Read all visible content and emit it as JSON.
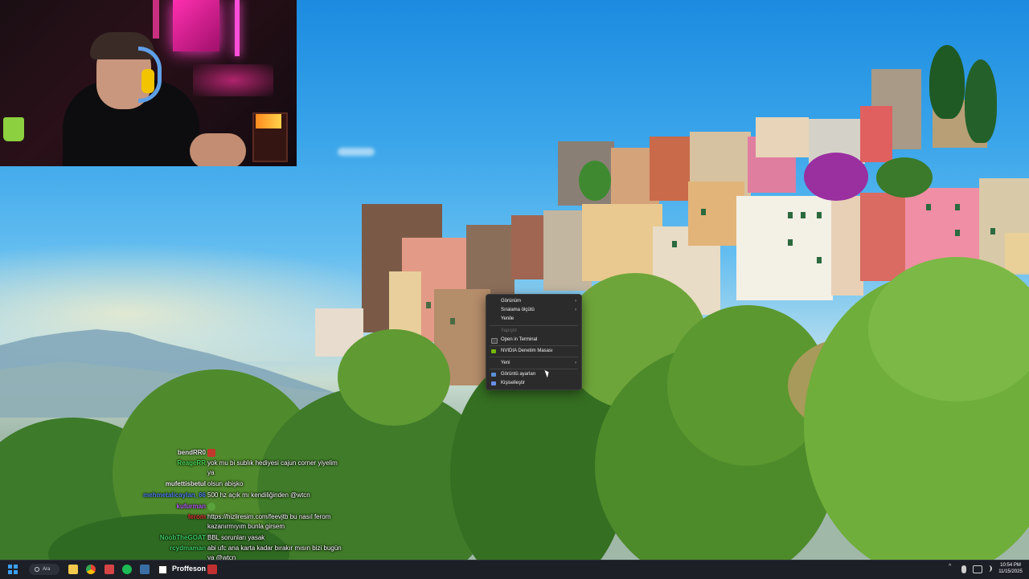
{
  "context_menu": {
    "items": [
      {
        "label": "Görünüm",
        "submenu": true,
        "icon": "",
        "disabled": false
      },
      {
        "label": "Sıralama ölçütü",
        "submenu": true,
        "icon": "",
        "disabled": false
      },
      {
        "label": "Yenile",
        "submenu": false,
        "icon": "",
        "disabled": false
      },
      {
        "label": "Yapıştır",
        "submenu": false,
        "icon": "",
        "disabled": true
      },
      {
        "label": "Open in Terminal",
        "submenu": false,
        "icon": "terminal-icon",
        "disabled": false
      },
      {
        "label": "NVIDIA Denetim Masası",
        "submenu": false,
        "icon": "nvidia-icon",
        "disabled": false
      },
      {
        "label": "Yeni",
        "submenu": true,
        "icon": "",
        "disabled": false
      },
      {
        "label": "Görüntü ayarları",
        "submenu": false,
        "icon": "display-settings-icon",
        "disabled": false
      },
      {
        "label": "Kişiselleştir",
        "submenu": false,
        "icon": "personalize-icon",
        "disabled": false
      }
    ],
    "submenu_glyph": "›"
  },
  "chat": {
    "messages": [
      {
        "user": "bendRR0",
        "text": "",
        "color": "#e8e8e8",
        "emote": "red"
      },
      {
        "user": "ReageRR",
        "text": "yok mu bi sublık hediyesi cajun corner yiyelim",
        "color": "#47d14f"
      },
      {
        "user": "",
        "text": "ya",
        "color": "#ffffff"
      },
      {
        "user": "mufettisbetul",
        "text": "olsun abişko",
        "color": "#e8e8e8"
      },
      {
        "user": "mehmetalicaylan_66",
        "text": "500 hz açık mı kendiliğinden @wtcn",
        "color": "#4a7ee8"
      },
      {
        "user": "kufurman",
        "text": "",
        "color": "#b45cf0",
        "emote": "green"
      },
      {
        "user": "ferom",
        "text": "https://hizliresim.com/feevjtb bu nasıl ferom",
        "color": "#e03434"
      },
      {
        "user": "",
        "text": "kazanırmıyım bunla girsem",
        "color": "#ffffff"
      },
      {
        "user": "NoobTheGOAT",
        "text": "BBL sorunları yasak",
        "color": "#3ac760"
      },
      {
        "user": "rcydmaman",
        "text": "abi ufc ana karta kadar bırakır mısın bizi bugün",
        "color": "#3ac760"
      },
      {
        "user": "",
        "text": "ya @wtcn",
        "color": "#ffffff"
      }
    ]
  },
  "taskbar": {
    "search_label": "Ara",
    "pinned_text": "Proffeson",
    "clock_time": "10:54 PM",
    "clock_date": "11/15/2025",
    "tray_expand": "^",
    "icons": [
      "start-icon",
      "search-icon",
      "file-explorer-icon",
      "chrome-icon",
      "calendar-app-icon",
      "spotify-icon",
      "steam-icon",
      "notion-icon",
      "app-icon"
    ]
  }
}
